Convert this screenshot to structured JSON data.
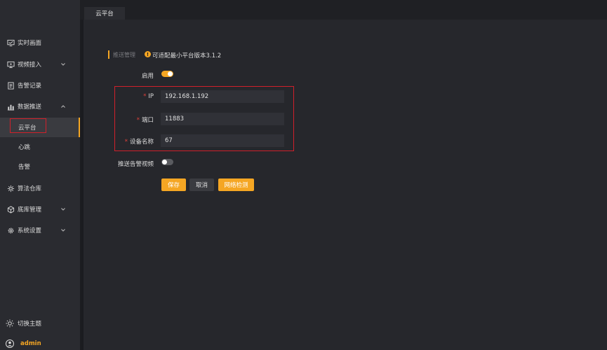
{
  "sidebar": {
    "items": [
      {
        "label": "实时画面",
        "icon": "monitor-icon"
      },
      {
        "label": "视频接入",
        "icon": "video-input-icon"
      },
      {
        "label": "告警记录",
        "icon": "alarm-record-icon"
      },
      {
        "label": "数据推送",
        "icon": "data-push-icon"
      },
      {
        "label": "算法仓库",
        "icon": "algorithm-icon"
      },
      {
        "label": "底库管理",
        "icon": "database-icon"
      },
      {
        "label": "系统设置",
        "icon": "gear-icon"
      }
    ],
    "subitems": [
      {
        "label": "云平台"
      },
      {
        "label": "心跳"
      },
      {
        "label": "告警"
      }
    ],
    "theme_label": "切换主题",
    "user_name": "admin"
  },
  "tabs": [
    {
      "label": "云平台"
    }
  ],
  "header": {
    "breadcrumb": "推送管理",
    "version_note": "可适配最小平台版本3.1.2"
  },
  "form": {
    "enable_label": "启用",
    "enable_on": true,
    "ip_label": "IP",
    "ip_value": "192.168.1.192",
    "port_label": "端口",
    "port_value": "11883",
    "device_label": "设备名称",
    "device_value": "67",
    "push_video_label": "推送告警视频",
    "push_video_on": false
  },
  "buttons": {
    "save": "保存",
    "cancel": "取消",
    "network_check": "网络检测"
  },
  "colors": {
    "accent": "#f5a623",
    "highlight_border": "#d0202a",
    "sidebar_bg": "#2a2b30",
    "content_bg": "#26272c"
  }
}
